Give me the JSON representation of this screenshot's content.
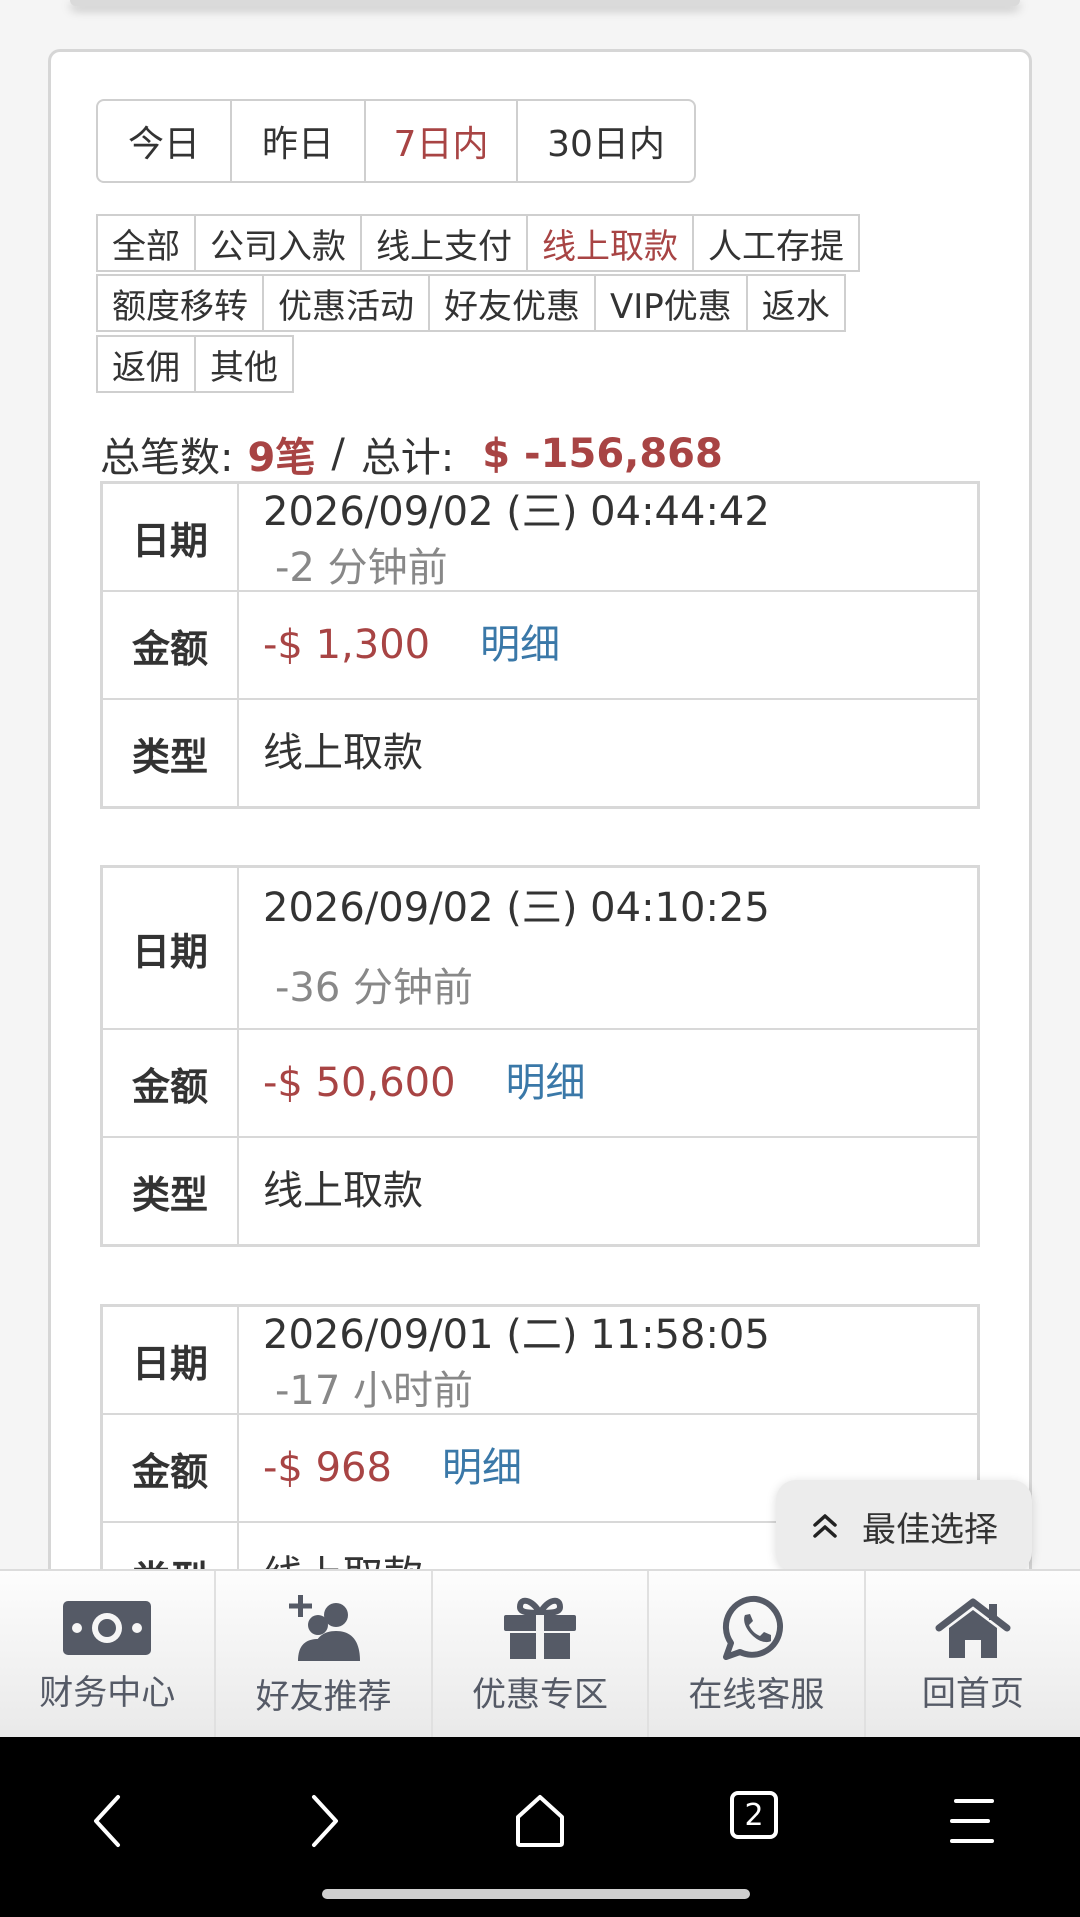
{
  "date_filters": [
    {
      "label": "今日",
      "active": false
    },
    {
      "label": "昨日",
      "active": false
    },
    {
      "label": "7日内",
      "active": true
    },
    {
      "label": "30日内",
      "active": false
    }
  ],
  "type_filters_row1": [
    {
      "label": "全部",
      "active": false
    },
    {
      "label": "公司入款",
      "active": false
    },
    {
      "label": "线上支付",
      "active": false
    },
    {
      "label": "线上取款",
      "active": true
    },
    {
      "label": "人工存提",
      "active": false
    }
  ],
  "type_filters_row2": [
    {
      "label": "额度移转",
      "active": false
    },
    {
      "label": "优惠活动",
      "active": false
    },
    {
      "label": "好友优惠",
      "active": false
    },
    {
      "label": "VIP优惠",
      "active": false
    },
    {
      "label": "返水",
      "active": false
    }
  ],
  "type_filters_row3": [
    {
      "label": "返佣",
      "active": false
    },
    {
      "label": "其他",
      "active": false
    }
  ],
  "summary": {
    "count_label": "总笔数:",
    "count": "9笔",
    "separator": "/",
    "total_label": "总计:",
    "total": "$ -156,868"
  },
  "labels": {
    "date": "日期",
    "amount": "金额",
    "type": "类型",
    "detail": "明细"
  },
  "records": [
    {
      "datetime": "2026/09/02 (三) 04:44:42",
      "ago": "-2 分钟前",
      "amount": "-$ 1,300",
      "type": "线上取款"
    },
    {
      "datetime": "2026/09/02 (三) 04:10:25",
      "ago": "-36 分钟前",
      "amount": "-$ 50,600",
      "type": "线上取款"
    },
    {
      "datetime": "2026/09/01 (二) 11:58:05",
      "ago": "-17 小时前",
      "amount": "-$ 968",
      "type": "线上取款"
    }
  ],
  "float_button": {
    "label": "最佳选择",
    "icon": "double-chevron-up-icon"
  },
  "tabbar": [
    {
      "label": "财务中心",
      "icon": "money-icon"
    },
    {
      "label": "好友推荐",
      "icon": "add-friends-icon"
    },
    {
      "label": "优惠专区",
      "icon": "gift-icon"
    },
    {
      "label": "在线客服",
      "icon": "whatsapp-icon"
    },
    {
      "label": "回首页",
      "icon": "home-icon"
    }
  ],
  "system_nav": {
    "tabs_count": "2"
  },
  "colors": {
    "accent_red": "#a84444",
    "link_blue": "#3a78a8",
    "tab_icon": "#555a66"
  }
}
